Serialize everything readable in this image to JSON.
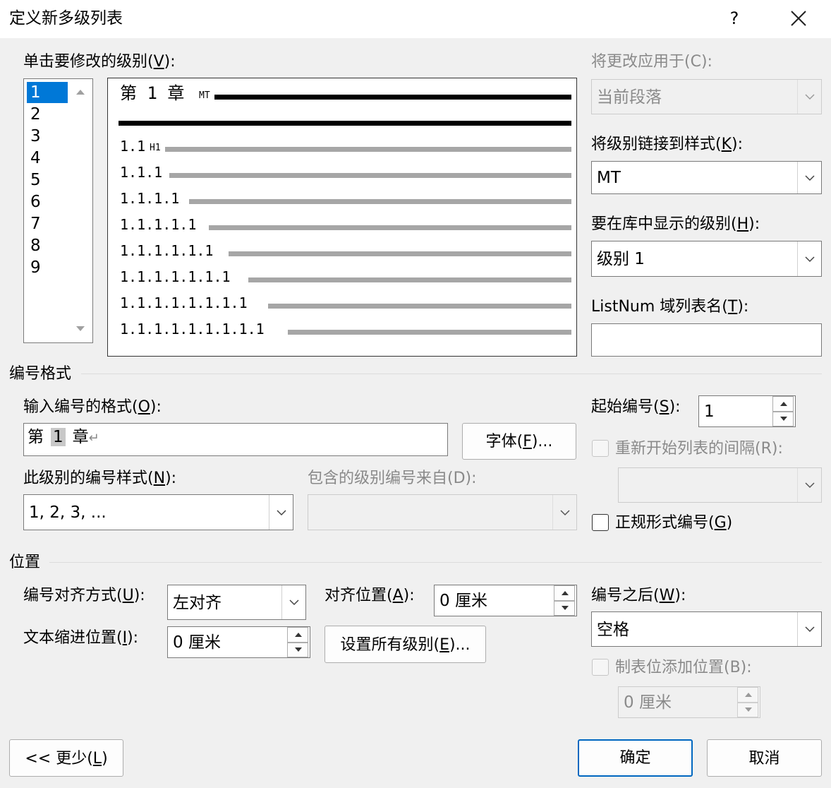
{
  "window": {
    "title": "定义新多级列表",
    "help_label": "?"
  },
  "level_list": {
    "label_pre": "单击要修改的级别(",
    "label_key": "V",
    "label_post": "):",
    "items": [
      "1",
      "2",
      "3",
      "4",
      "5",
      "6",
      "7",
      "8",
      "9"
    ],
    "selected": "1"
  },
  "preview": {
    "level1": {
      "w1": "第",
      "num": "1",
      "w2": "章",
      "style_tag": "MT"
    },
    "level2": {
      "number": "1.1",
      "style_tag": "H1"
    },
    "levels": [
      "1.1.1",
      "1.1.1.1",
      "1.1.1.1.1",
      "1.1.1.1.1.1",
      "1.1.1.1.1.1.1",
      "1.1.1.1.1.1.1.1",
      "1.1.1.1.1.1.1.1.1"
    ]
  },
  "right_panel": {
    "apply_to": {
      "label": "将更改应用于(C):",
      "value": "当前段落"
    },
    "link_style": {
      "label_pre": "将级别链接到样式(",
      "label_key": "K",
      "label_post": "):",
      "value": "MT"
    },
    "gallery_level": {
      "label_pre": "要在库中显示的级别(",
      "label_key": "H",
      "label_post": "):",
      "value": "级别 1"
    },
    "listnum": {
      "label_pre": "ListNum 域列表名(",
      "label_key": "T",
      "label_post": "):",
      "value": ""
    }
  },
  "number_format": {
    "section_title": "编号格式",
    "input_label_pre": "输入编号的格式(",
    "input_label_key": "O",
    "input_label_post": "):",
    "format_prefix": "第",
    "format_number": "1",
    "format_suffix": "章",
    "paragraph_mark": "↵",
    "font_button_pre": "字体(",
    "font_button_key": "F",
    "font_button_post": ")...",
    "style_label_pre": "此级别的编号样式(",
    "style_label_key": "N",
    "style_label_post": "):",
    "style_value": "1, 2, 3, ...",
    "include_label": "包含的级别编号来自(D):",
    "include_value": "",
    "start_label_pre": "起始编号(",
    "start_label_key": "S",
    "start_label_post": "):",
    "start_value": "1",
    "restart_label": "重新开始列表的间隔(R):",
    "restart_checked": false,
    "restart_value": "",
    "legal_label_pre": "正规形式编号(",
    "legal_label_key": "G",
    "legal_label_post": ")",
    "legal_checked": false
  },
  "position": {
    "section_title": "位置",
    "align_label_pre": "编号对齐方式(",
    "align_label_key": "U",
    "align_label_post": "):",
    "align_value": "左对齐",
    "align_at_label_pre": "对齐位置(",
    "align_at_label_key": "A",
    "align_at_label_post": "):",
    "align_at_value": "0 厘米",
    "indent_label_pre": "文本缩进位置(",
    "indent_label_key": "I",
    "indent_label_post": "):",
    "indent_value": "0 厘米",
    "set_all_pre": "设置所有级别(",
    "set_all_key": "E",
    "set_all_post": ")...",
    "follow_label_pre": "编号之后(",
    "follow_label_key": "W",
    "follow_label_post": "):",
    "follow_value": "空格",
    "tab_label": "制表位添加位置(B):",
    "tab_checked": false,
    "tab_value": "0 厘米"
  },
  "footer": {
    "less_pre": "<< 更少(",
    "less_key": "L",
    "less_post": ")",
    "ok": "确定",
    "cancel": "取消"
  },
  "colors": {
    "selection": "#0078d7",
    "primary_border": "#0067c0",
    "disabled_text": "#8a8a8a",
    "preview_bar_active": "#000000",
    "preview_bar_inactive": "#a6a6a6"
  }
}
